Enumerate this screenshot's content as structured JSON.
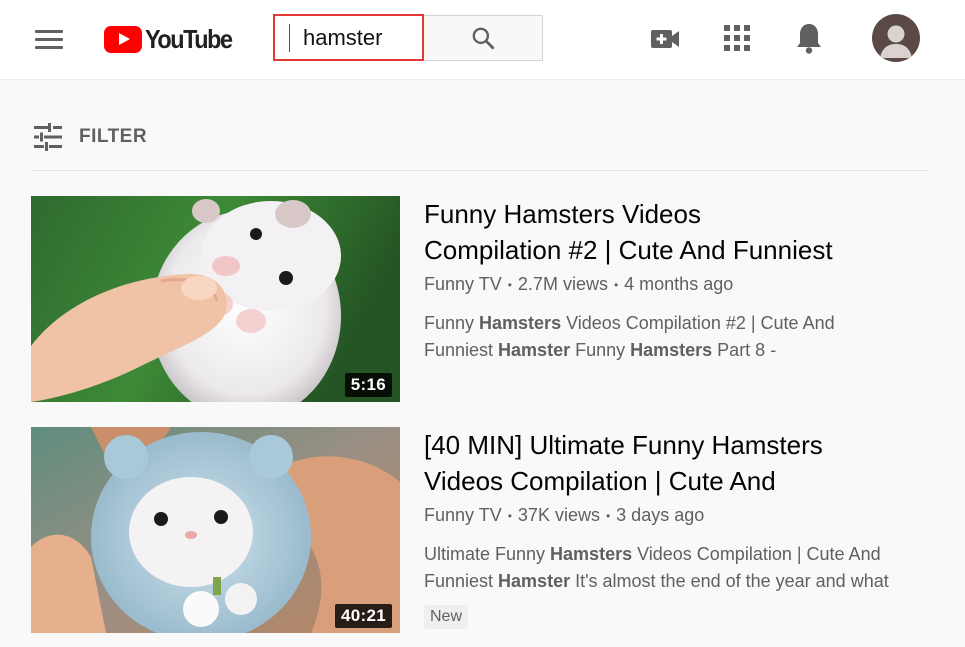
{
  "masthead": {
    "logo_text": "YouTube",
    "search": {
      "value": "hamster"
    },
    "icons": [
      "menu-icon",
      "search-icon",
      "video-camera-plus-icon",
      "apps-grid-icon",
      "bell-icon",
      "avatar"
    ]
  },
  "filter": {
    "label": "FILTER"
  },
  "results": [
    {
      "title_line1": "Funny Hamsters Videos",
      "title_line2": "Compilation #2 | Cute And Funniest",
      "channel": "Funny TV",
      "views": "2.7M views",
      "age": "4 months ago",
      "duration": "5:16",
      "desc_line1": [
        {
          "t": "Funny ",
          "b": false
        },
        {
          "t": "Hamsters",
          "b": true
        },
        {
          "t": " Videos Compilation #2 | Cute And",
          "b": false
        }
      ],
      "desc_line2": [
        {
          "t": "Funniest ",
          "b": false
        },
        {
          "t": "Hamster",
          "b": true
        },
        {
          "t": " Funny ",
          "b": false
        },
        {
          "t": "Hamsters",
          "b": true
        },
        {
          "t": " Part 8 -",
          "b": false
        }
      ]
    },
    {
      "title_line1": "[40 MIN] Ultimate Funny Hamsters",
      "title_line2": "Videos Compilation | Cute And",
      "channel": "Funny TV",
      "views": "37K views",
      "age": "3 days ago",
      "duration": "40:21",
      "badge": "New",
      "desc_line1": [
        {
          "t": "Ultimate Funny ",
          "b": false
        },
        {
          "t": "Hamsters",
          "b": true
        },
        {
          "t": " Videos Compilation | Cute And",
          "b": false
        }
      ],
      "desc_line2": [
        {
          "t": "Funniest ",
          "b": false
        },
        {
          "t": "Hamster",
          "b": true
        },
        {
          "t": " It's almost the end of the year and what",
          "b": false
        }
      ]
    }
  ],
  "colors": {
    "brand_red": "#ff0000",
    "search_highlight": "#e53935",
    "text_primary": "#030303",
    "text_secondary": "#606060"
  }
}
